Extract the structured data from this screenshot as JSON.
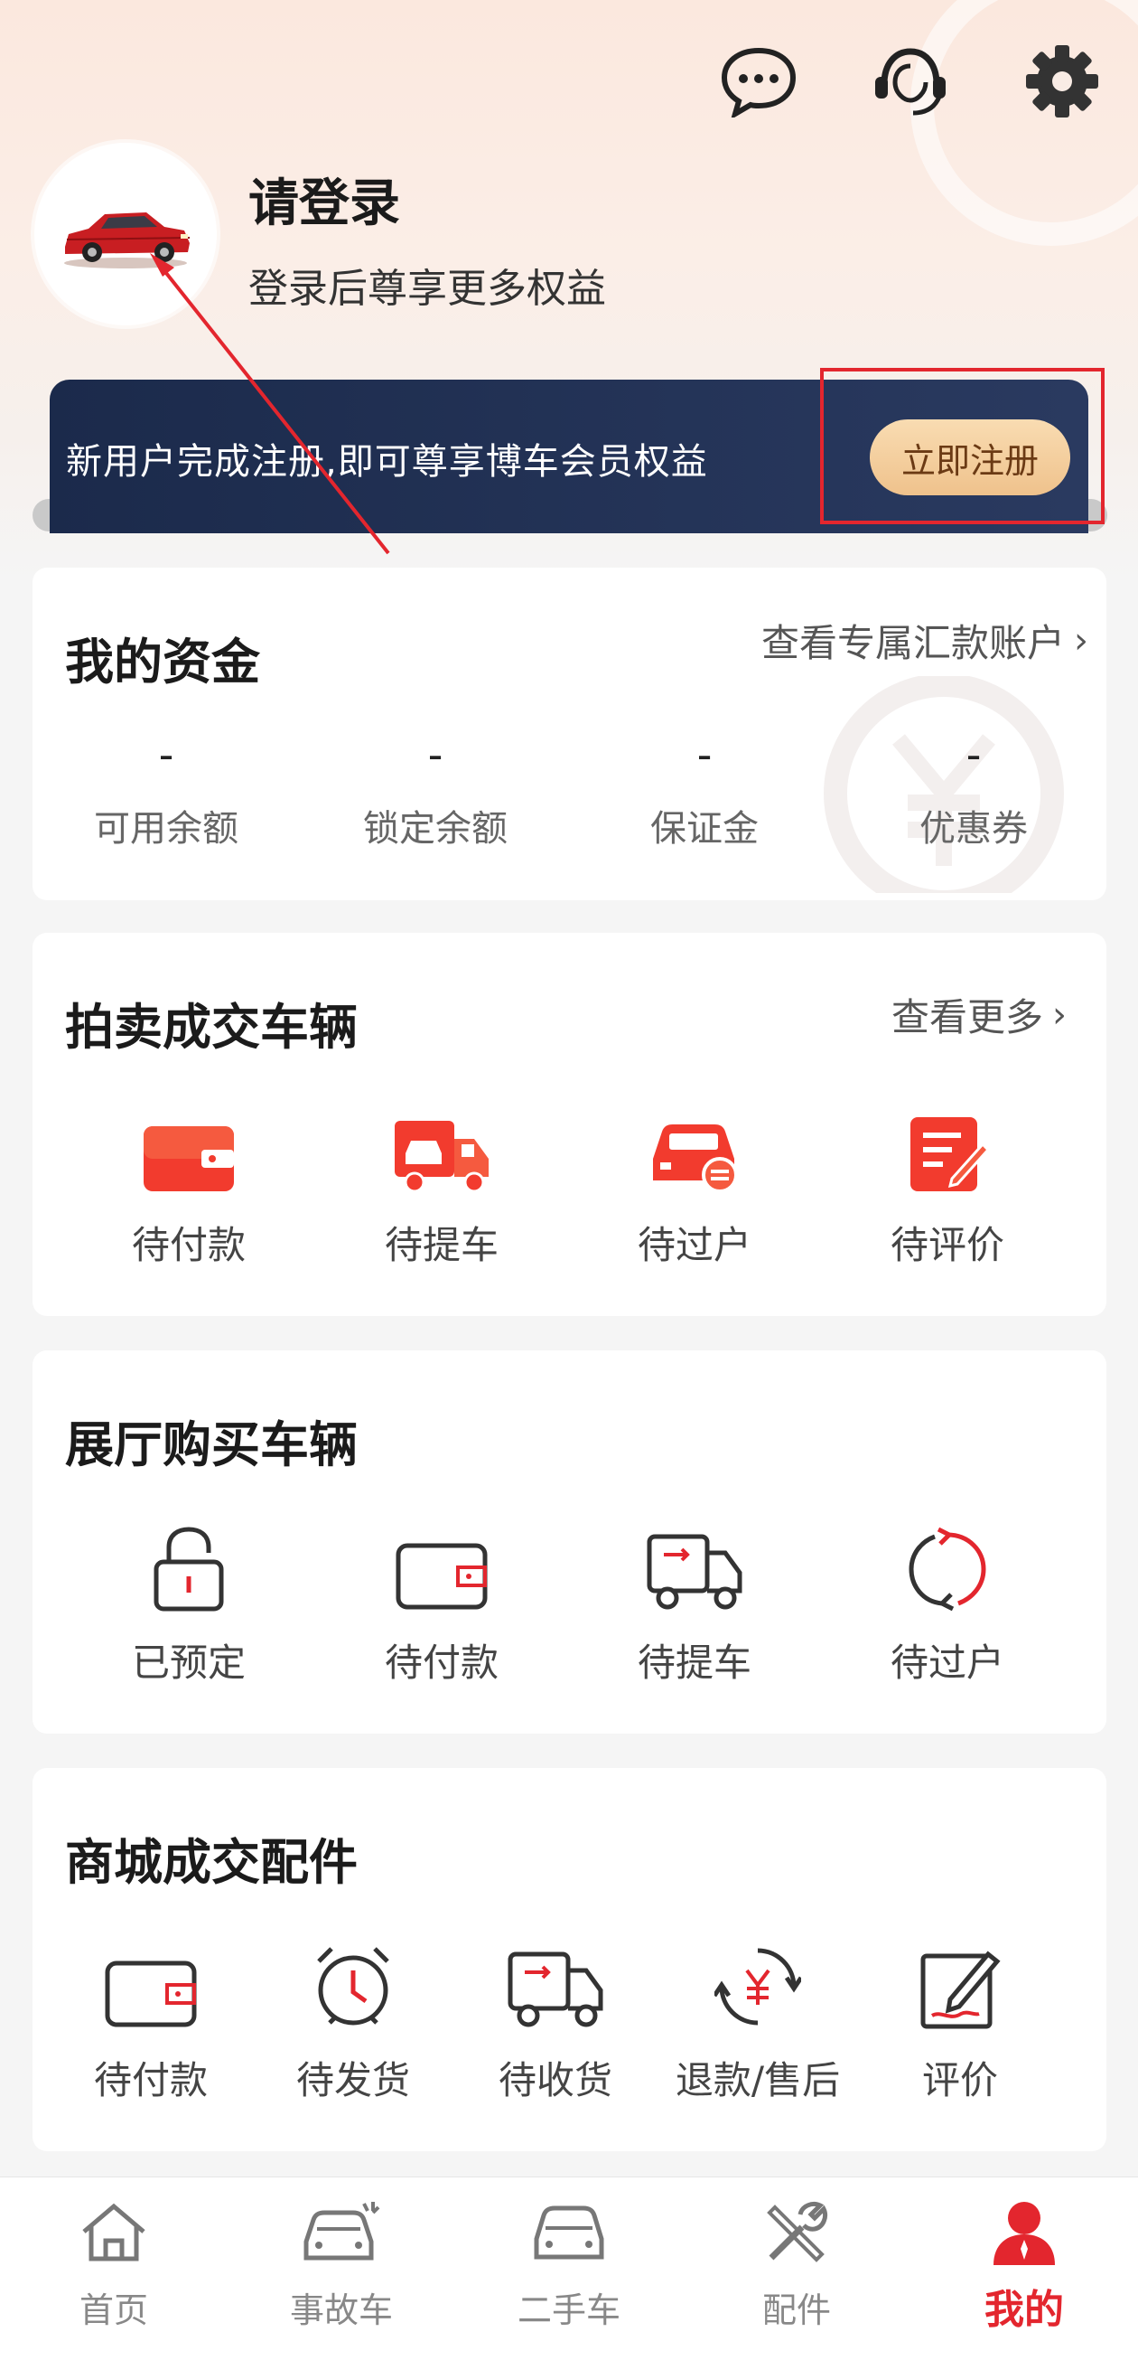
{
  "colors": {
    "accent": "#e3262e",
    "banner": "#1b2a4b",
    "gold": "#efc28c"
  },
  "header": {
    "title": "请登录",
    "subtitle": "登录后尊享更多权益",
    "icons": [
      "message-icon",
      "customer-service-icon",
      "settings-icon"
    ]
  },
  "banner": {
    "text": "新用户完成注册,即可尊享博车会员权益",
    "button": "立即注册"
  },
  "funds": {
    "title": "我的资金",
    "link": "查看专属汇款账户",
    "items": [
      {
        "value": "-",
        "label": "可用余额"
      },
      {
        "value": "-",
        "label": "锁定余额"
      },
      {
        "value": "-",
        "label": "保证金"
      },
      {
        "value": "-",
        "label": "优惠券"
      }
    ]
  },
  "auction": {
    "title": "拍卖成交车辆",
    "link": "查看更多",
    "items": [
      {
        "label": "待付款",
        "icon": "wallet-icon"
      },
      {
        "label": "待提车",
        "icon": "truck-icon"
      },
      {
        "label": "待过户",
        "icon": "car-transfer-icon"
      },
      {
        "label": "待评价",
        "icon": "review-icon"
      }
    ]
  },
  "showroom": {
    "title": "展厅购买车辆",
    "items": [
      {
        "label": "已预定",
        "icon": "lock-icon"
      },
      {
        "label": "待付款",
        "icon": "wallet-icon"
      },
      {
        "label": "待提车",
        "icon": "truck-icon"
      },
      {
        "label": "待过户",
        "icon": "refresh-icon"
      }
    ]
  },
  "mall": {
    "title": "商城成交配件",
    "items": [
      {
        "label": "待付款",
        "icon": "wallet-icon"
      },
      {
        "label": "待发货",
        "icon": "alarm-clock-icon"
      },
      {
        "label": "待收货",
        "icon": "delivery-truck-icon"
      },
      {
        "label": "退款/售后",
        "icon": "refund-icon"
      },
      {
        "label": "评价",
        "icon": "edit-icon"
      }
    ]
  },
  "tabbar": {
    "items": [
      {
        "label": "首页",
        "icon": "home-icon"
      },
      {
        "label": "事故车",
        "icon": "accident-car-icon"
      },
      {
        "label": "二手车",
        "icon": "used-car-icon"
      },
      {
        "label": "配件",
        "icon": "tools-icon"
      },
      {
        "label": "我的",
        "icon": "profile-icon",
        "active": true
      }
    ]
  }
}
